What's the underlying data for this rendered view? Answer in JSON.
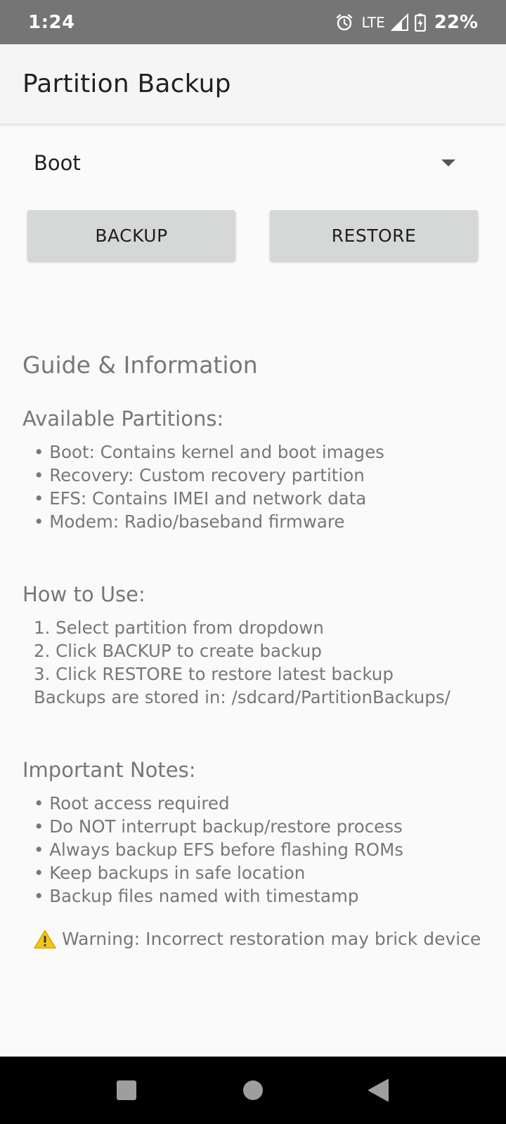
{
  "status_bar": {
    "time": "1:24",
    "network": "LTE",
    "battery_percent": "22%",
    "icons": [
      "alarm-icon",
      "signal-icon",
      "battery-charging-icon"
    ]
  },
  "app_bar": {
    "title": "Partition Backup"
  },
  "partition_spinner": {
    "selected": "Boot"
  },
  "buttons": {
    "backup": "BACKUP",
    "restore": "RESTORE"
  },
  "guide": {
    "title": "Guide & Information",
    "sections": [
      {
        "heading": "Available Partitions:",
        "lines": [
          "• Boot: Contains kernel and boot images",
          "• Recovery: Custom recovery partition",
          "• EFS: Contains IMEI and network data",
          "• Modem: Radio/baseband firmware"
        ]
      },
      {
        "heading": "How to Use:",
        "lines": [
          "1. Select partition from dropdown",
          "2. Click BACKUP to create backup",
          "3. Click RESTORE to restore latest backup",
          "Backups are stored in: /sdcard/PartitionBackups/"
        ]
      },
      {
        "heading": "Important Notes:",
        "lines": [
          "• Root access required",
          "• Do NOT interrupt backup/restore process",
          "• Always backup EFS before flashing ROMs",
          "• Keep backups in safe location",
          "• Backup files named with timestamp"
        ]
      }
    ],
    "warning": "Warning: Incorrect restoration may brick device"
  },
  "nav_bar": {
    "icons": [
      "recents-icon",
      "home-icon",
      "back-icon"
    ]
  },
  "colors": {
    "status_bar": "#757575",
    "app_bar": "#f5f5f5",
    "button": "#d6d7d7",
    "body_text": "#777777",
    "warning_icon": "#f5c518"
  }
}
